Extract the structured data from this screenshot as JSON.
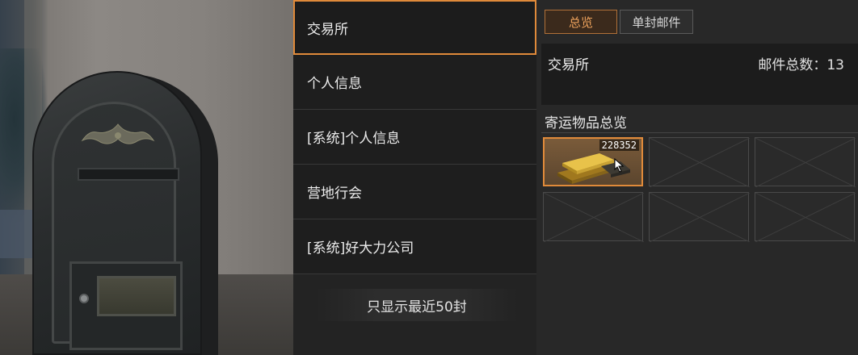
{
  "mail_list": {
    "items": [
      {
        "label": "交易所",
        "selected": true
      },
      {
        "label": "个人信息",
        "selected": false
      },
      {
        "label": "[系统]个人信息",
        "selected": false
      },
      {
        "label": "营地行会",
        "selected": false
      },
      {
        "label": "[系统]好大力公司",
        "selected": false
      }
    ],
    "footer_note": "只显示最近50封"
  },
  "tabs": {
    "overview": "总览",
    "single_mail": "单封邮件",
    "active": "overview"
  },
  "info": {
    "sender": "交易所",
    "total_label": "邮件总数：13"
  },
  "shipment": {
    "title": "寄运物品总览",
    "slots": [
      {
        "item_icon": "gold-bars-icon",
        "quantity": "228352",
        "filled": true
      },
      {
        "filled": false
      },
      {
        "filled": false
      },
      {
        "filled": false
      },
      {
        "filled": false
      },
      {
        "filled": false
      }
    ]
  },
  "colors": {
    "accent": "#e08a3a",
    "tab_active_text": "#eda25c",
    "list_bg": "#1e1e1e",
    "panel_bg": "#282828"
  }
}
